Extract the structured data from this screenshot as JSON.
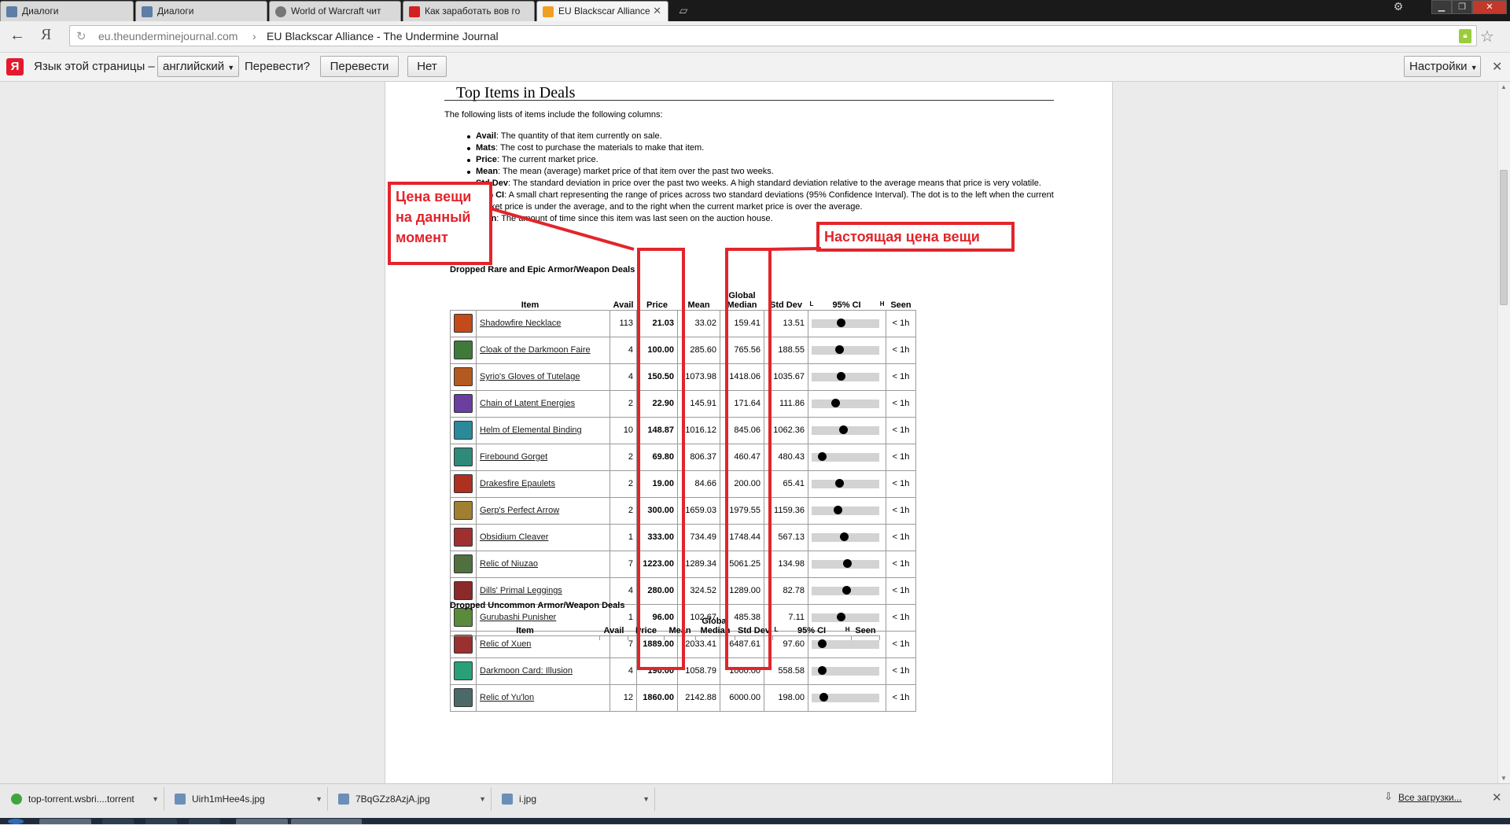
{
  "tabs": [
    {
      "label": "Диалоги",
      "icon": "vk-icon"
    },
    {
      "label": "Диалоги",
      "icon": "vk-icon"
    },
    {
      "label": "World of Warcraft чит",
      "icon": "wow-icon"
    },
    {
      "label": "Как заработать вов го",
      "icon": "youtube-icon"
    },
    {
      "label": "EU Blackscar Alliance",
      "icon": "undermine-icon"
    }
  ],
  "address": {
    "domain": "eu.theunderminejournal.com",
    "separator": "›",
    "title": "EU Blackscar Alliance - The Undermine Journal"
  },
  "translate_bar": {
    "page_lang_label": "Язык этой страницы –",
    "language": "английский",
    "question": "Перевести?",
    "translate_btn": "Перевести",
    "no_btn": "Нет",
    "settings_btn": "Настройки"
  },
  "page": {
    "title": "Top Items in Deals",
    "intro": "The following lists of items include the following columns:",
    "definitions": [
      {
        "term": "Avail",
        "text": ": The quantity of that item currently on sale."
      },
      {
        "term": "Mats",
        "text": ": The cost to purchase the materials to make that item."
      },
      {
        "term": "Price",
        "text": ": The current market price."
      },
      {
        "term": "Mean",
        "text": ": The mean (average) market price of that item over the past two weeks."
      },
      {
        "term": "Std Dev",
        "text": ": The standard deviation in price over the past two weeks. A high standard deviation relative to the average means that price is very volatile."
      },
      {
        "term": "95% CI",
        "text": ": A small chart representing the range of prices across two standard deviations (95% Confidence Interval). The dot is to the left when the current market price is under the average, and to the right when the current market price is over the average."
      },
      {
        "term": "Seen",
        "text": ": The amount of time since this item was last seen on the auction house."
      }
    ],
    "section1_title": "Dropped Rare and Epic Armor/Weapon Deals",
    "section2_title": "Dropped Uncommon Armor/Weapon Deals",
    "headers": {
      "item": "Item",
      "avail": "Avail",
      "price": "Price",
      "mean": "Mean",
      "gmed_1": "Global",
      "gmed_2": "Median",
      "sd": "Std Dev",
      "ci_l": "L",
      "ci": "95% CI",
      "ci_h": "H",
      "seen": "Seen"
    },
    "rows": [
      {
        "name": "Shadowfire Necklace",
        "avail": "113",
        "price": "21.03",
        "mean": "33.02",
        "gmed": "159.41",
        "sd": "13.51",
        "ci_pos": 0.43,
        "seen": "< 1h",
        "color": "#c44a1a"
      },
      {
        "name": "Cloak of the Darkmoon Faire",
        "avail": "4",
        "price": "100.00",
        "mean": "285.60",
        "gmed": "765.56",
        "sd": "188.55",
        "ci_pos": 0.41,
        "seen": "< 1h",
        "color": "#3f7a3a"
      },
      {
        "name": "Syrio's Gloves of Tutelage",
        "avail": "4",
        "price": "150.50",
        "mean": "1073.98",
        "gmed": "1418.06",
        "sd": "1035.67",
        "ci_pos": 0.43,
        "seen": "< 1h",
        "color": "#b45a20"
      },
      {
        "name": "Chain of Latent Energies",
        "avail": "2",
        "price": "22.90",
        "mean": "145.91",
        "gmed": "171.64",
        "sd": "111.86",
        "ci_pos": 0.35,
        "seen": "< 1h",
        "color": "#6a3fa0"
      },
      {
        "name": "Helm of Elemental Binding",
        "avail": "10",
        "price": "148.87",
        "mean": "1016.12",
        "gmed": "845.06",
        "sd": "1062.36",
        "ci_pos": 0.46,
        "seen": "< 1h",
        "color": "#2a8a9a"
      },
      {
        "name": "Firebound Gorget",
        "avail": "2",
        "price": "69.80",
        "mean": "806.37",
        "gmed": "460.47",
        "sd": "480.43",
        "ci_pos": 0.15,
        "seen": "< 1h",
        "color": "#2f8a7a"
      },
      {
        "name": "Drakesfire Epaulets",
        "avail": "2",
        "price": "19.00",
        "mean": "84.66",
        "gmed": "200.00",
        "sd": "65.41",
        "ci_pos": 0.41,
        "seen": "< 1h",
        "color": "#b03020"
      },
      {
        "name": "Gerp's Perfect Arrow",
        "avail": "2",
        "price": "300.00",
        "mean": "1659.03",
        "gmed": "1979.55",
        "sd": "1159.36",
        "ci_pos": 0.38,
        "seen": "< 1h",
        "color": "#a08030"
      },
      {
        "name": "Obsidium Cleaver",
        "avail": "1",
        "price": "333.00",
        "mean": "734.49",
        "gmed": "1748.44",
        "sd": "567.13",
        "ci_pos": 0.48,
        "seen": "< 1h",
        "color": "#a03030"
      },
      {
        "name": "Relic of Niuzao",
        "avail": "7",
        "price": "1223.00",
        "mean": "1289.34",
        "gmed": "5061.25",
        "sd": "134.98",
        "ci_pos": 0.52,
        "seen": "< 1h",
        "color": "#507040"
      },
      {
        "name": "Dills' Primal Leggings",
        "avail": "4",
        "price": "280.00",
        "mean": "324.52",
        "gmed": "1289.00",
        "sd": "82.78",
        "ci_pos": 0.51,
        "seen": "< 1h",
        "color": "#8a2a2a"
      },
      {
        "name": "Gurubashi Punisher",
        "avail": "1",
        "price": "96.00",
        "mean": "102.67",
        "gmed": "485.38",
        "sd": "7.11",
        "ci_pos": 0.43,
        "seen": "< 1h",
        "color": "#5a8a3a"
      },
      {
        "name": "Relic of Xuen",
        "avail": "7",
        "price": "1889.00",
        "mean": "2033.41",
        "gmed": "6487.61",
        "sd": "97.60",
        "ci_pos": 0.15,
        "seen": "< 1h",
        "color": "#9a3030"
      },
      {
        "name": "Darkmoon Card: Illusion",
        "avail": "4",
        "price": "190.00",
        "mean": "1058.79",
        "gmed": "1000.00",
        "sd": "558.58",
        "ci_pos": 0.15,
        "seen": "< 1h",
        "color": "#2aa07a"
      },
      {
        "name": "Relic of Yu'lon",
        "avail": "12",
        "price": "1860.00",
        "mean": "2142.88",
        "gmed": "6000.00",
        "sd": "198.00",
        "ci_pos": 0.17,
        "seen": "< 1h",
        "color": "#4a6a6a"
      }
    ]
  },
  "annotations": {
    "price_note": "Цена вещи на данный момент",
    "median_note": "Настоящая цена вещи",
    "color": "#e3242b"
  },
  "downloads": [
    {
      "name": "top-torrent.wsbri....torrent",
      "icon": "utorrent-icon"
    },
    {
      "name": "Uirh1mHee4s.jpg",
      "icon": "image-file-icon"
    },
    {
      "name": "7BqGZz8AzjA.jpg",
      "icon": "image-file-icon"
    },
    {
      "name": "i.jpg",
      "icon": "image-file-icon"
    }
  ],
  "all_downloads": "Все загрузки..."
}
